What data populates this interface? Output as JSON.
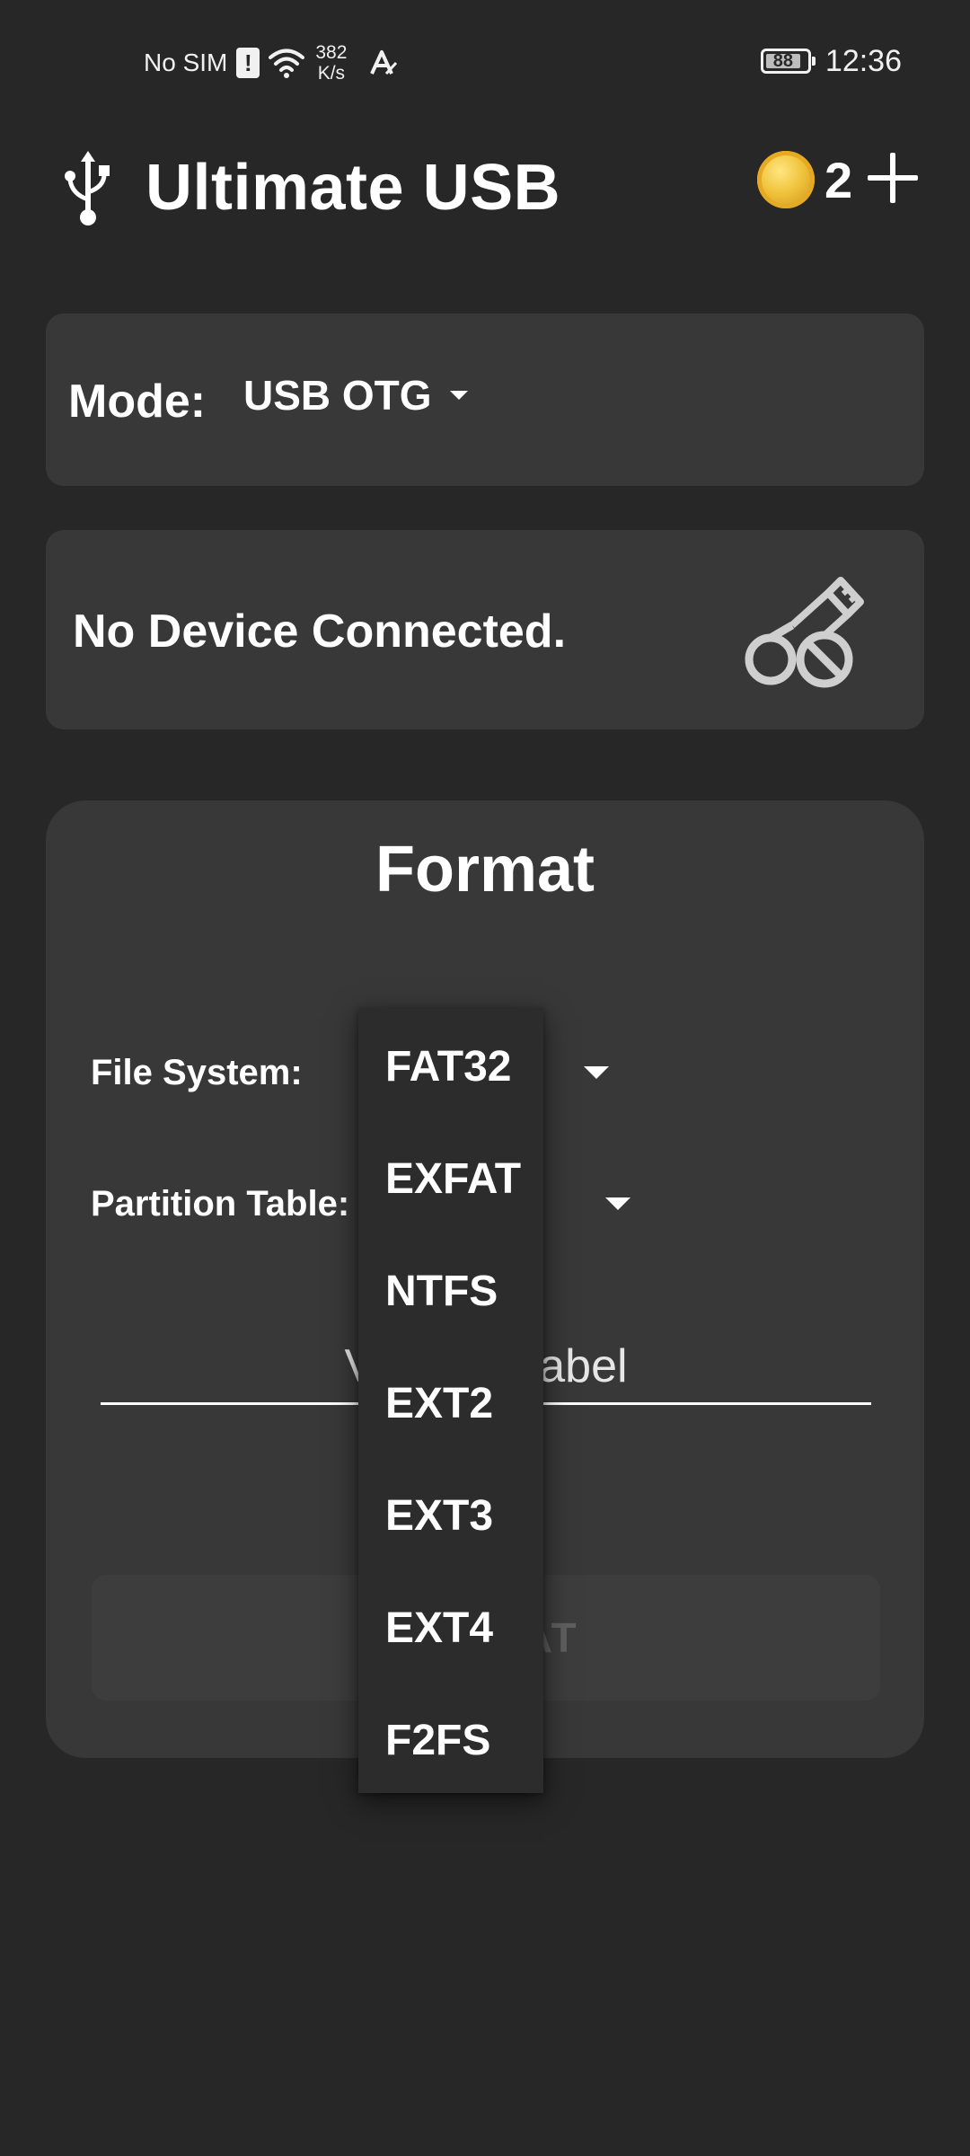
{
  "status_bar": {
    "carrier": "No SIM",
    "alert_glyph": "!",
    "net_speed_value": "382",
    "net_speed_unit": "K/s",
    "battery_level": "88",
    "time": "12:36",
    "icons": [
      "sim-alert-icon",
      "wifi-icon",
      "auto-icon",
      "battery-icon"
    ]
  },
  "app_bar": {
    "title": "Ultimate USB",
    "coin_count": "2",
    "icons": [
      "usb-icon",
      "coin-icon",
      "plus-icon"
    ]
  },
  "mode_card": {
    "label": "Mode:",
    "value": "USB OTG"
  },
  "device_card": {
    "status": "No Device Connected.",
    "icon": "usb-blocked-icon"
  },
  "format_card": {
    "title": "Format",
    "file_system_label": "File System:",
    "partition_table_label": "Partition Table:",
    "volume_label_placeholder": "Volume Label",
    "format_button_label": "FORMAT"
  },
  "file_system_dropdown": {
    "options": [
      "FAT32",
      "EXFAT",
      "NTFS",
      "EXT2",
      "EXT3",
      "EXT4",
      "F2FS"
    ]
  },
  "colors": {
    "background": "#272727",
    "card": "#383838",
    "dropdown": "#2c2c2c",
    "coin": "#f0c23b",
    "disabled_text": "#5f5f5f"
  }
}
